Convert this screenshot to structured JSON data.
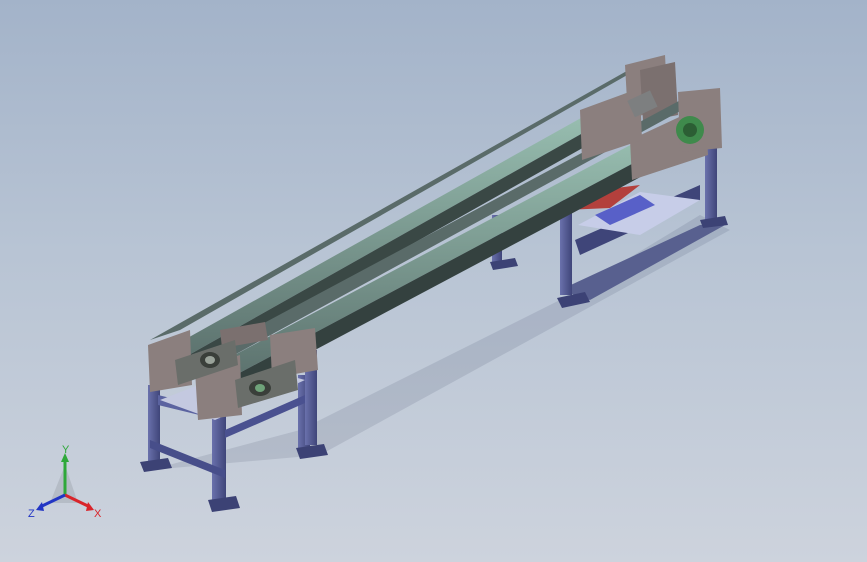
{
  "viewport": {
    "background_top": "#a3b3c9",
    "background_bottom": "#cdd3dd"
  },
  "model": {
    "frame_color": "#535a94",
    "frame_dark": "#3c4275",
    "plate_color": "#8b7f7e",
    "plate_dark": "#5f5656",
    "rail_color": "#4c5c5a",
    "rail_light": "#8fb8aa",
    "motor_color": "#3f8a4c",
    "part_red": "#b3403c"
  },
  "triad": {
    "x_label": "X",
    "y_label": "Y",
    "z_label": "Z",
    "x_color": "#d9242a",
    "y_color": "#2fa83a",
    "z_color": "#2235c4"
  }
}
